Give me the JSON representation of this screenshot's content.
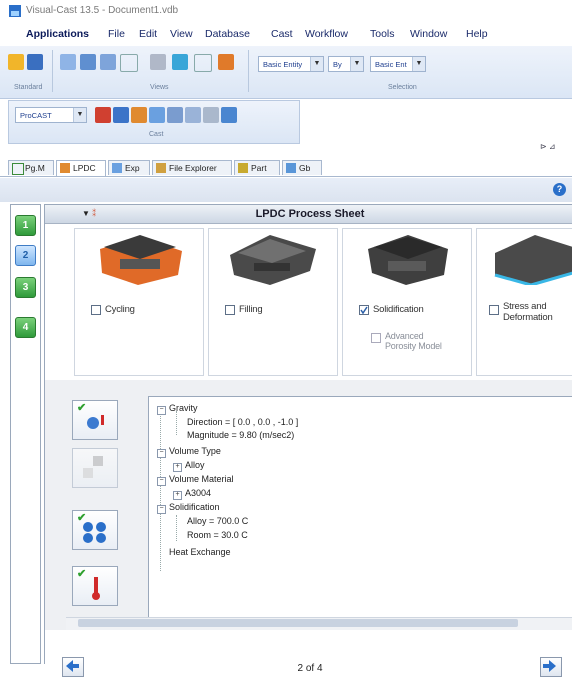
{
  "app": {
    "title": "Visual-Cast 13.5 - Document1.vdb"
  },
  "menu": [
    "Applications",
    "File",
    "Edit",
    "View",
    "Database",
    "Cast",
    "Workflow",
    "Tools",
    "Window",
    "Help"
  ],
  "ribbon": {
    "groups": [
      "Standard",
      "Views",
      "Selection",
      "Cast"
    ],
    "entity_combo": "Basic Entity",
    "by_combo": "By",
    "entity_combo2": "Basic Ent",
    "solver_combo": "ProCAST"
  },
  "tabs": [
    "Pg.M",
    "LPDC",
    "Exp",
    "File Explorer",
    "Part",
    "Gb"
  ],
  "steps": [
    "1",
    "2",
    "3",
    "4"
  ],
  "sheet": {
    "title": "LPDC Process Sheet",
    "cards": [
      {
        "label": "Cycling",
        "checked": false
      },
      {
        "label": "Filling",
        "checked": false
      },
      {
        "label": "Solidification",
        "checked": true,
        "sub": "Advanced Porosity Model"
      },
      {
        "label": "Stress and Deformation",
        "checked": false
      }
    ]
  },
  "tree": {
    "gravity": "Gravity",
    "direction": "Direction = [ 0.0 , 0.0 , -1.0 ]",
    "magnitude": "Magnitude = 9.80 (m/sec2)",
    "volume_type": "Volume Type",
    "alloy": "Alloy",
    "volume_material": "Volume Material",
    "a3004": "A3004",
    "solidification": "Solidification",
    "alloy_temp": "Alloy = 700.0 C",
    "room_temp": "Room = 30.0 C",
    "heat_exchange": "Heat Exchange"
  },
  "pager": {
    "text": "2 of 4"
  },
  "colors": {
    "step_green": "#2f9a3a",
    "accent_blue": "#2a6fc9"
  }
}
